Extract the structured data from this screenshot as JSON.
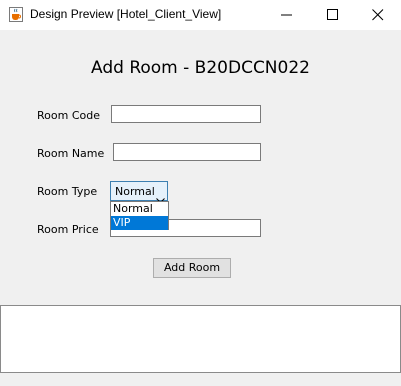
{
  "window": {
    "title": "Design Preview [Hotel_Client_View]",
    "icon": "java-cup-icon",
    "controls": [
      "minimize-icon",
      "maximize-icon",
      "close-icon"
    ]
  },
  "form": {
    "heading": "Add Room - B20DCCN022",
    "room_code_label": "Room Code",
    "room_code_value": "",
    "room_name_label": "Room Name",
    "room_name_value": "",
    "room_type_label": "Room Type",
    "room_type_selected": "Normal",
    "room_type_options": [
      "Normal",
      "VIP"
    ],
    "room_type_highlighted": "VIP",
    "room_price_label": "Room Price",
    "room_price_value": "",
    "add_button_label": "Add Room"
  },
  "output": {
    "text": ""
  },
  "colors": {
    "selection": "#0078d7",
    "combo_focus_border": "#3c7fb1",
    "background": "#f0f0f0"
  }
}
